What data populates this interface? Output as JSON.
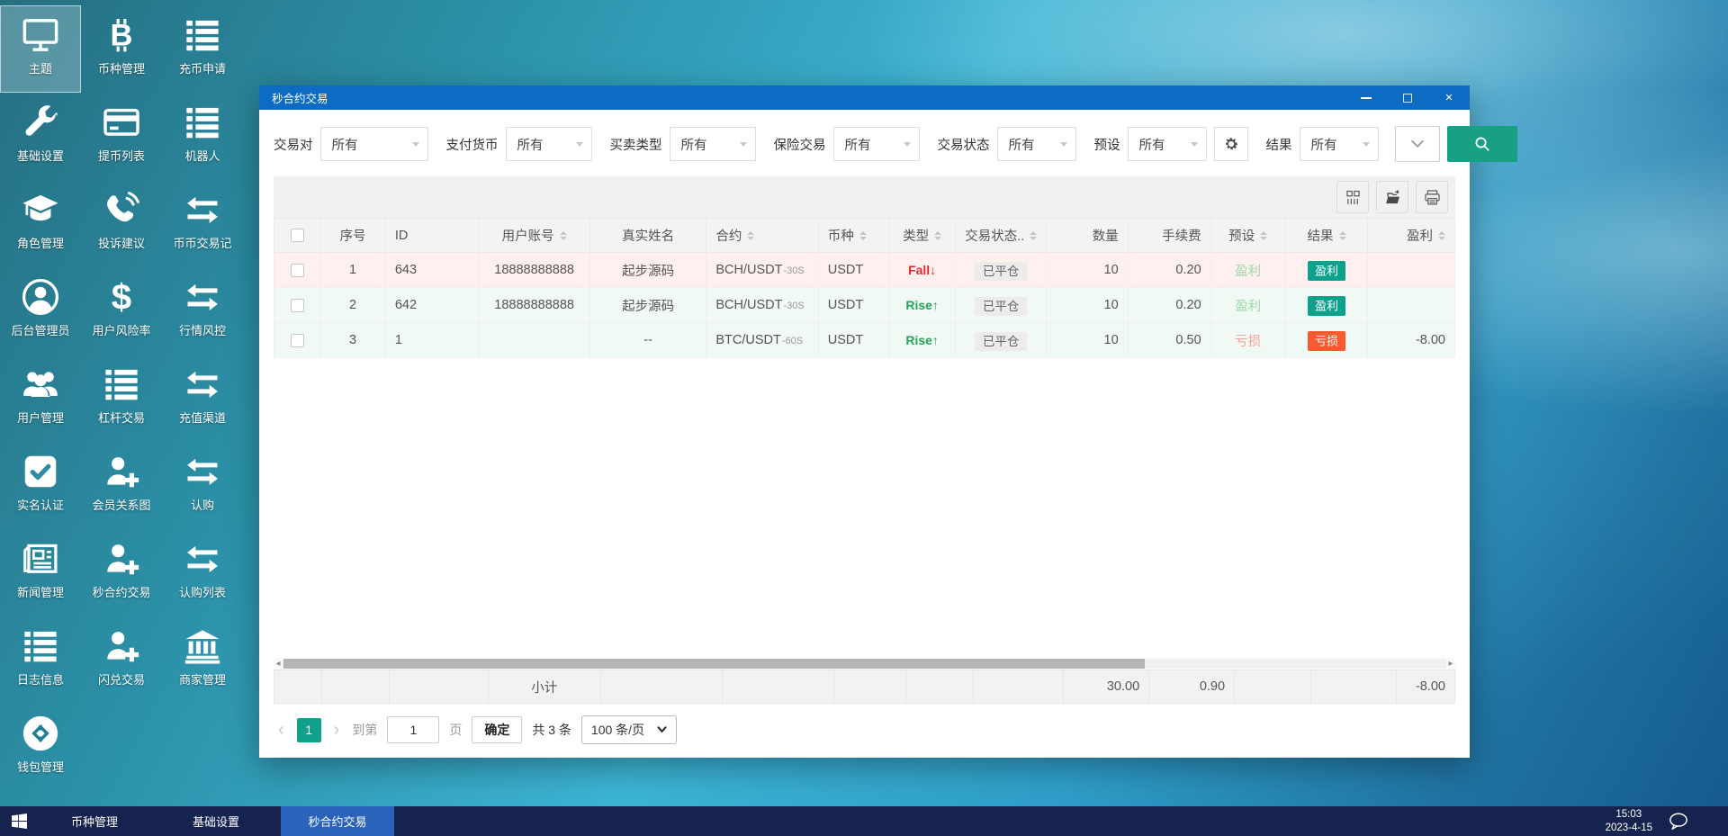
{
  "desktop": {
    "icons": [
      {
        "label": "主题",
        "icon": "monitor-icon",
        "selected": true
      },
      {
        "label": "币种管理",
        "icon": "bitcoin-icon"
      },
      {
        "label": "充币申请",
        "icon": "list-icon"
      },
      {
        "label": "基础设置",
        "icon": "wrench-icon"
      },
      {
        "label": "提币列表",
        "icon": "card-icon"
      },
      {
        "label": "机器人",
        "icon": "list-icon"
      },
      {
        "label": "角色管理",
        "icon": "graduation-cap-icon"
      },
      {
        "label": "投诉建议",
        "icon": "phone-icon"
      },
      {
        "label": "币币交易记",
        "icon": "swap-icon"
      },
      {
        "label": "后台管理员",
        "icon": "user-circle-icon"
      },
      {
        "label": "用户风险率",
        "icon": "dollar-icon"
      },
      {
        "label": "行情风控",
        "icon": "swap-icon"
      },
      {
        "label": "用户管理",
        "icon": "users-icon"
      },
      {
        "label": "杠杆交易",
        "icon": "list-icon"
      },
      {
        "label": "充值渠道",
        "icon": "swap-icon"
      },
      {
        "label": "实名认证",
        "icon": "check-square-icon"
      },
      {
        "label": "会员关系图",
        "icon": "user-plus-icon"
      },
      {
        "label": "认购",
        "icon": "swap-icon"
      },
      {
        "label": "新闻管理",
        "icon": "newspaper-icon"
      },
      {
        "label": "秒合约交易",
        "icon": "user-plus-icon"
      },
      {
        "label": "认购列表",
        "icon": "swap-icon"
      },
      {
        "label": "日志信息",
        "icon": "list-icon"
      },
      {
        "label": "闪兑交易",
        "icon": "user-plus-icon"
      },
      {
        "label": "商家管理",
        "icon": "bank-icon"
      },
      {
        "label": "钱包管理",
        "icon": "wallet-icon"
      }
    ]
  },
  "window": {
    "title": "秒合约交易",
    "filters": [
      {
        "label": "交易对",
        "value": "所有"
      },
      {
        "label": "支付货币",
        "value": "所有"
      },
      {
        "label": "买卖类型",
        "value": "所有"
      },
      {
        "label": "保险交易",
        "value": "所有"
      },
      {
        "label": "交易状态",
        "value": "所有"
      },
      {
        "label": "预设",
        "value": "所有",
        "has_gear": true
      },
      {
        "label": "结果",
        "value": "所有"
      }
    ],
    "toolbar": {
      "buttons": [
        "columns-icon",
        "export-icon",
        "print-icon"
      ]
    },
    "table": {
      "columns": [
        {
          "type": "checkbox",
          "label": ""
        },
        {
          "label": "序号"
        },
        {
          "label": "ID"
        },
        {
          "label": "用户账号",
          "sortable": true
        },
        {
          "label": "真实姓名"
        },
        {
          "label": "合约",
          "sortable": true
        },
        {
          "label": "币种",
          "sortable": true
        },
        {
          "label": "类型",
          "sortable": true
        },
        {
          "label": "交易状态..",
          "sortable": true
        },
        {
          "label": "数量"
        },
        {
          "label": "手续费"
        },
        {
          "label": "预设",
          "sortable": true
        },
        {
          "label": "结果",
          "sortable": true
        },
        {
          "label": "盈利",
          "sortable": true
        }
      ],
      "rows": [
        {
          "tint": "red",
          "seq": "1",
          "id": "643",
          "account": "18888888888",
          "name": "起步源码",
          "contract": "BCH/USDT",
          "contract_suffix": "-30S",
          "coin": "USDT",
          "type": "Fall↓",
          "type_dir": "down",
          "status": "已平仓",
          "amount": "10",
          "fee": "0.20",
          "preset": "盈利",
          "preset_kind": "profit",
          "result": "盈利",
          "result_kind": "profit",
          "profit": ""
        },
        {
          "tint": "green",
          "seq": "2",
          "id": "642",
          "account": "18888888888",
          "name": "起步源码",
          "contract": "BCH/USDT",
          "contract_suffix": "-30S",
          "coin": "USDT",
          "type": "Rise↑",
          "type_dir": "up",
          "status": "已平仓",
          "amount": "10",
          "fee": "0.20",
          "preset": "盈利",
          "preset_kind": "profit",
          "result": "盈利",
          "result_kind": "profit",
          "profit": ""
        },
        {
          "tint": "green",
          "seq": "3",
          "id": "1",
          "account": "",
          "name": "--",
          "contract": "BTC/USDT",
          "contract_suffix": "-60S",
          "coin": "USDT",
          "type": "Rise↑",
          "type_dir": "up",
          "status": "已平仓",
          "amount": "10",
          "fee": "0.50",
          "preset": "亏损",
          "preset_kind": "loss",
          "result": "亏损",
          "result_kind": "loss",
          "profit": "-8.00"
        }
      ],
      "summary": {
        "label": "小计",
        "amount": "30.00",
        "fee": "0.90",
        "profit": "-8.00"
      }
    },
    "pagination": {
      "page": "1",
      "goto_label": "到第",
      "goto_value": "1",
      "page_label": "页",
      "confirm_label": "确定",
      "total_label": "共 3 条",
      "page_size": "100 条/页"
    }
  },
  "taskbar": {
    "items": [
      {
        "label": "币种管理"
      },
      {
        "label": "基础设置"
      },
      {
        "label": "秒合约交易",
        "active": true
      }
    ],
    "time": "15:03",
    "date": "2023-4-15"
  },
  "colors": {
    "title_bar_blue": "#0c6cc4",
    "accent_teal": "#17a084",
    "badge_profit_green": "#0ca18c",
    "badge_loss_orange": "#fa5a30",
    "rise_green": "#28a25c",
    "fall_red": "#e02b2b",
    "preset_profit_light": "#9fd8ab",
    "preset_loss_light": "#f5a09a",
    "row_tint_red": "#fdf0ef",
    "row_tint_green": "#f1f9f4",
    "taskbar_navy": "#16234e",
    "taskbar_active_blue": "#2b63bb"
  }
}
